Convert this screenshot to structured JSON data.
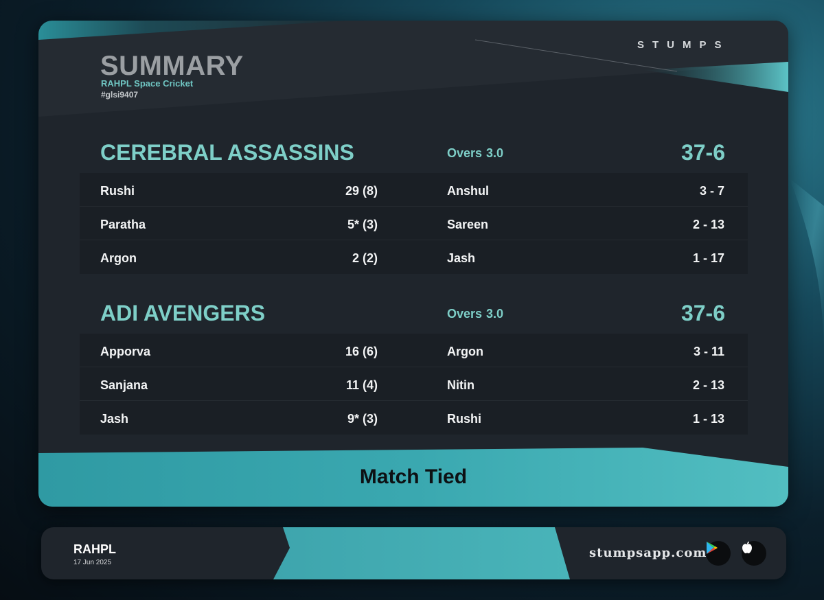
{
  "header": {
    "title": "SUMMARY",
    "subtitle": "RAHPL Space Cricket",
    "match_id": "#glsi9407",
    "brand": "STUMPS"
  },
  "innings": [
    {
      "team": "CEREBRAL ASSASSINS",
      "overs_label": "Overs",
      "overs": "3.0",
      "score": "37-6",
      "rows": [
        {
          "batter": "Rushi",
          "bat_score": "29 (8)",
          "bowler": "Anshul",
          "bowl_fig": "3 - 7"
        },
        {
          "batter": "Paratha",
          "bat_score": "5* (3)",
          "bowler": "Sareen",
          "bowl_fig": "2 - 13"
        },
        {
          "batter": "Argon",
          "bat_score": "2 (2)",
          "bowler": "Jash",
          "bowl_fig": "1 - 17"
        }
      ]
    },
    {
      "team": "ADI AVENGERS",
      "overs_label": "Overs",
      "overs": "3.0",
      "score": "37-6",
      "rows": [
        {
          "batter": "Apporva",
          "bat_score": "16 (6)",
          "bowler": "Argon",
          "bowl_fig": "3 - 11"
        },
        {
          "batter": "Sanjana",
          "bat_score": "11 (4)",
          "bowler": "Nitin",
          "bowl_fig": "2 - 13"
        },
        {
          "batter": "Jash",
          "bat_score": "9* (3)",
          "bowler": "Rushi",
          "bowl_fig": "1 - 13"
        }
      ]
    }
  ],
  "result": "Match Tied",
  "footer": {
    "league": "RAHPL",
    "date": "17 Jun 2025",
    "site": "stumpsapp.com",
    "store_icons": [
      "google-play-icon",
      "apple-icon"
    ]
  },
  "colors": {
    "accent": "#7ecfc8",
    "teal_band": "#3fa9b0",
    "card_bg": "#1f252c",
    "row_bg": "#1a1f25"
  }
}
